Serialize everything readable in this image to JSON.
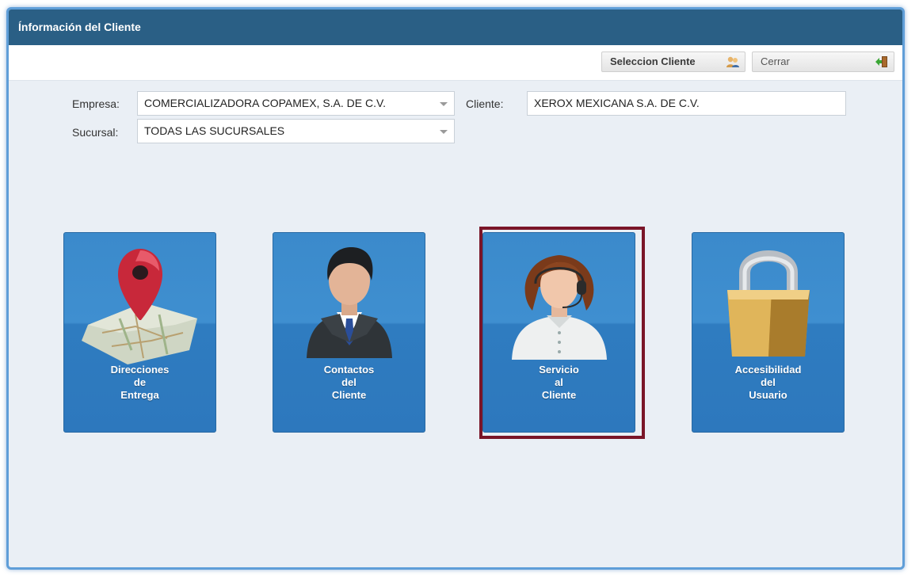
{
  "window": {
    "title": "Ínformación del Cliente"
  },
  "toolbar": {
    "select_client_label": "Seleccion Cliente",
    "close_label": "Cerrar"
  },
  "form": {
    "empresa_label": "Empresa:",
    "empresa_value": "COMERCIALIZADORA COPAMEX, S.A. DE C.V.",
    "cliente_label": "Cliente:",
    "cliente_value": "XEROX MEXICANA S.A. DE C.V.",
    "sucursal_label": "Sucursal:",
    "sucursal_value": "TODAS LAS SUCURSALES"
  },
  "tiles": [
    {
      "lines": [
        "Direcciones",
        "de",
        "Entrega"
      ],
      "icon": "map-pin-icon"
    },
    {
      "lines": [
        "Contactos",
        "del",
        "Cliente"
      ],
      "icon": "businessman-icon"
    },
    {
      "lines": [
        "Servicio",
        "al",
        "Cliente"
      ],
      "icon": "headset-agent-icon"
    },
    {
      "lines": [
        "Accesibilidad",
        "del",
        "Usuario"
      ],
      "icon": "padlock-icon"
    }
  ],
  "colors": {
    "titlebar": "#2a5f85",
    "tile_blue": "#3b8acb",
    "selected_border": "#7a1528"
  }
}
